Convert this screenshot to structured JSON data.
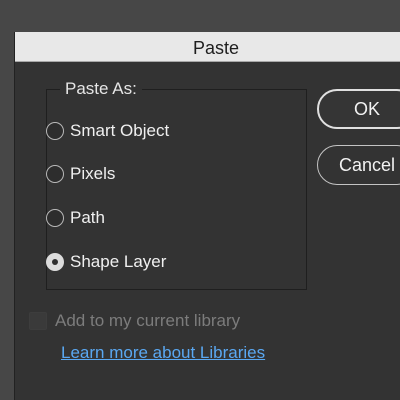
{
  "dialog": {
    "title": "Paste",
    "group_title": "Paste As:",
    "options": [
      {
        "label": "Smart Object",
        "selected": false
      },
      {
        "label": "Pixels",
        "selected": false
      },
      {
        "label": "Path",
        "selected": false
      },
      {
        "label": "Shape Layer",
        "selected": true
      }
    ],
    "ok_label": "OK",
    "cancel_label": "Cancel",
    "library_checkbox": {
      "label": "Add to my current library",
      "checked": false,
      "enabled": false
    },
    "learn_more_link": "Learn more about Libraries"
  },
  "colors": {
    "dialog_bg": "#333333",
    "titlebar_bg": "#e8e8e8",
    "link": "#5aa8f2"
  }
}
